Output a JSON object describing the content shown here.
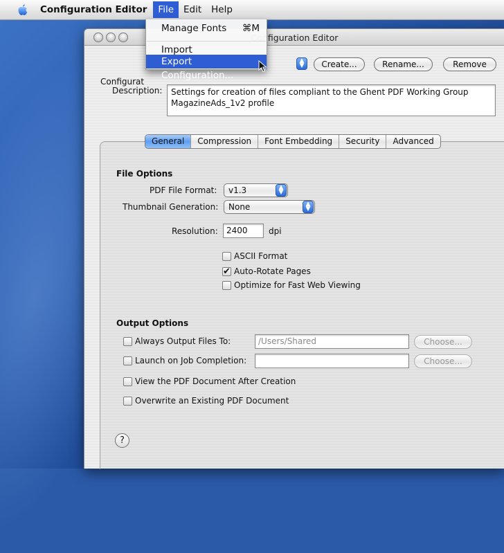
{
  "menubar": {
    "app": "Configuration Editor",
    "items": [
      "File",
      "Edit",
      "Help"
    ]
  },
  "file_menu": {
    "items": [
      {
        "label": "Manage Fonts",
        "shortcut": "⌘M"
      },
      {
        "label": "Import Configuration..."
      },
      {
        "label": "Export Configuration..."
      }
    ]
  },
  "window": {
    "title": "Configuration Editor",
    "config_label": "Configurat",
    "buttons": {
      "create": "Create...",
      "rename": "Rename...",
      "remove": "Remove"
    },
    "description_label": "Description:",
    "description_line1": "Settings for creation of files compliant to the Ghent PDF Working Group",
    "description_line2": "MagazineAds_1v2 profile"
  },
  "tabs": [
    "General",
    "Compression",
    "Font Embedding",
    "Security",
    "Advanced"
  ],
  "file_options": {
    "title": "File Options",
    "pdf_format_label": "PDF File Format:",
    "pdf_format_value": "v1.3",
    "thumbnail_label": "Thumbnail Generation:",
    "thumbnail_value": "None",
    "resolution_label": "Resolution:",
    "resolution_value": "2400",
    "resolution_unit": "dpi",
    "ascii_label": "ASCII Format",
    "autorotate_label": "Auto-Rotate Pages",
    "optimize_label": "Optimize for Fast Web Viewing",
    "ascii_checked": false,
    "autorotate_checked": true,
    "optimize_checked": false
  },
  "output_options": {
    "title": "Output Options",
    "always_output_label": "Always Output Files To:",
    "always_output_path": "/Users/Shared",
    "launch_label": "Launch on Job Completion:",
    "launch_value": "",
    "choose_label": "Choose...",
    "view_label": "View the PDF Document After Creation",
    "overwrite_label": "Overwrite an Existing PDF Document"
  },
  "help_label": "?"
}
